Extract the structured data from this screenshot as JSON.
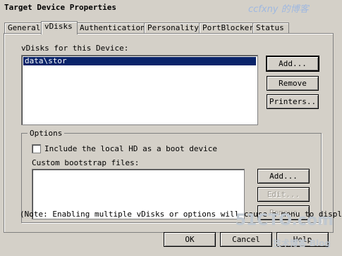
{
  "window": {
    "title": "Target Device Properties",
    "watermark_top": "ccfxny 的博客"
  },
  "tabs": [
    {
      "label": "General"
    },
    {
      "label": "vDisks"
    },
    {
      "label": "Authentication"
    },
    {
      "label": "Personality"
    },
    {
      "label": "PortBlocker"
    },
    {
      "label": "Status"
    }
  ],
  "vdisks": {
    "label": "vDisks for this Device:",
    "items": [
      "data\\stor"
    ],
    "add_label": "Add...",
    "remove_label": "Remove",
    "printers_label": "Printers.."
  },
  "options": {
    "legend": "Options",
    "include_local_hd_label": "Include the local HD as a boot device",
    "include_local_hd_checked": false,
    "custom_bootstrap_label": "Custom bootstrap files:",
    "add_label": "Add...",
    "edit_label": "Edit...",
    "remove_label": "Remove"
  },
  "note": "(Note: Enabling multiple vDisks or options will cause a menu to display",
  "footer": {
    "ok_label": "OK",
    "cancel_label": "Cancel",
    "help_label": "Help"
  },
  "watermark": {
    "site": "51CTO.com",
    "tagline": "技术博客 Blog"
  }
}
